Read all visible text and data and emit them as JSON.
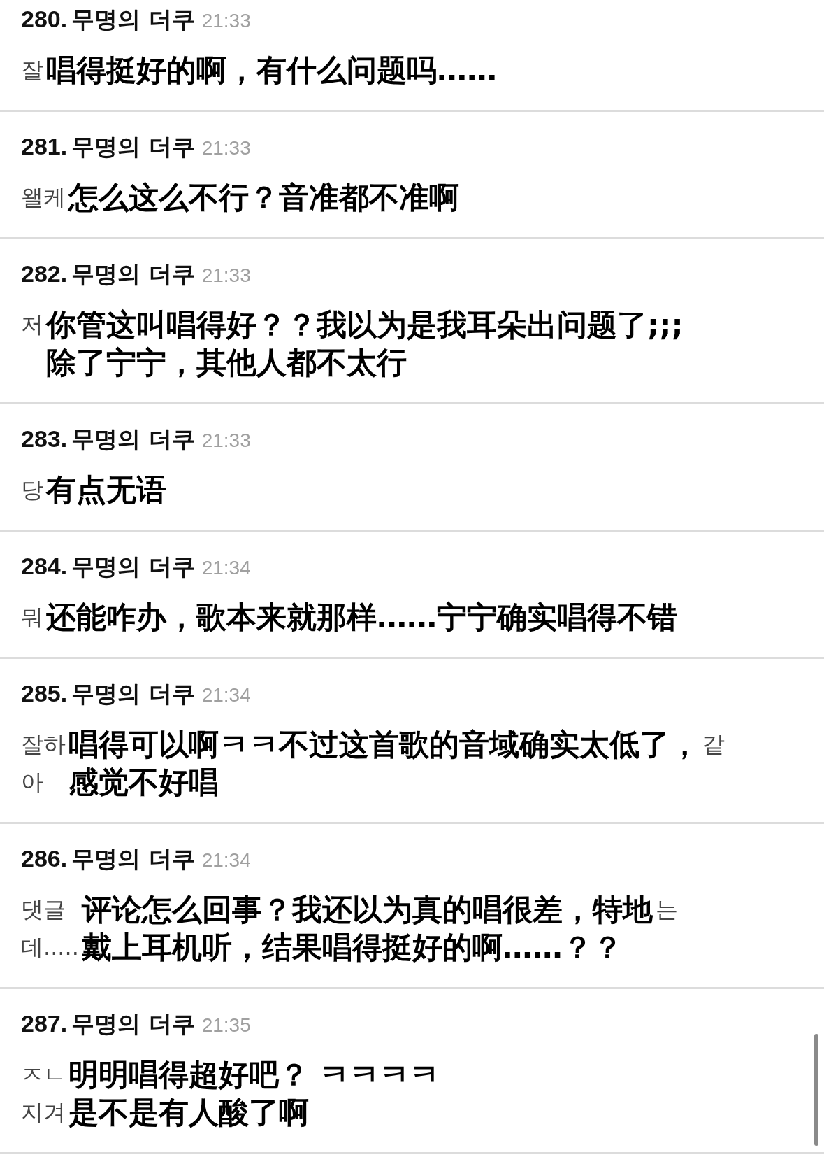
{
  "comments": [
    {
      "number": "280.",
      "author": "무명의 더쿠",
      "time": "21:33",
      "left": [
        "잘"
      ],
      "translation": [
        "唱得挺好的啊，有什么问题吗……"
      ]
    },
    {
      "number": "281.",
      "author": "무명의 더쿠",
      "time": "21:33",
      "left": [
        "왤케"
      ],
      "translation": [
        "怎么这么不行？音准都不准啊"
      ]
    },
    {
      "number": "282.",
      "author": "무명의 더쿠",
      "time": "21:33",
      "left": [
        "저"
      ],
      "translation": [
        "你管这叫唱得好？？我以为是我耳朵出问题了;;;",
        "除了宁宁，其他人都不太行"
      ]
    },
    {
      "number": "283.",
      "author": "무명의 더쿠",
      "time": "21:33",
      "left": [
        "당"
      ],
      "translation": [
        "有点无语"
      ]
    },
    {
      "number": "284.",
      "author": "무명의 더쿠",
      "time": "21:34",
      "left": [
        "뭐"
      ],
      "translation": [
        "还能咋办，歌本来就那样……宁宁确实唱得不错"
      ]
    },
    {
      "number": "285.",
      "author": "무명의 더쿠",
      "time": "21:34",
      "left": [
        "잘하",
        "아"
      ],
      "translation": [
        "唱得可以啊ㅋㅋ不过这首歌的音域确实太低了，",
        "感觉不好唱"
      ],
      "right": [
        "같"
      ]
    },
    {
      "number": "286.",
      "author": "무명의 더쿠",
      "time": "21:34",
      "left": [
        "댓글",
        "데....."
      ],
      "translation": [
        "评论怎么回事？我还以为真的唱很差，特地",
        "戴上耳机听，结果唱得挺好的啊……？？"
      ],
      "right": [
        "는"
      ]
    },
    {
      "number": "287.",
      "author": "무명의 더쿠",
      "time": "21:35",
      "left": [
        "ㅈㄴ",
        "지겨"
      ],
      "translation": [
        "明明唱得超好吧？ ㅋㅋㅋㅋ",
        "是不是有人酸了啊"
      ]
    }
  ]
}
